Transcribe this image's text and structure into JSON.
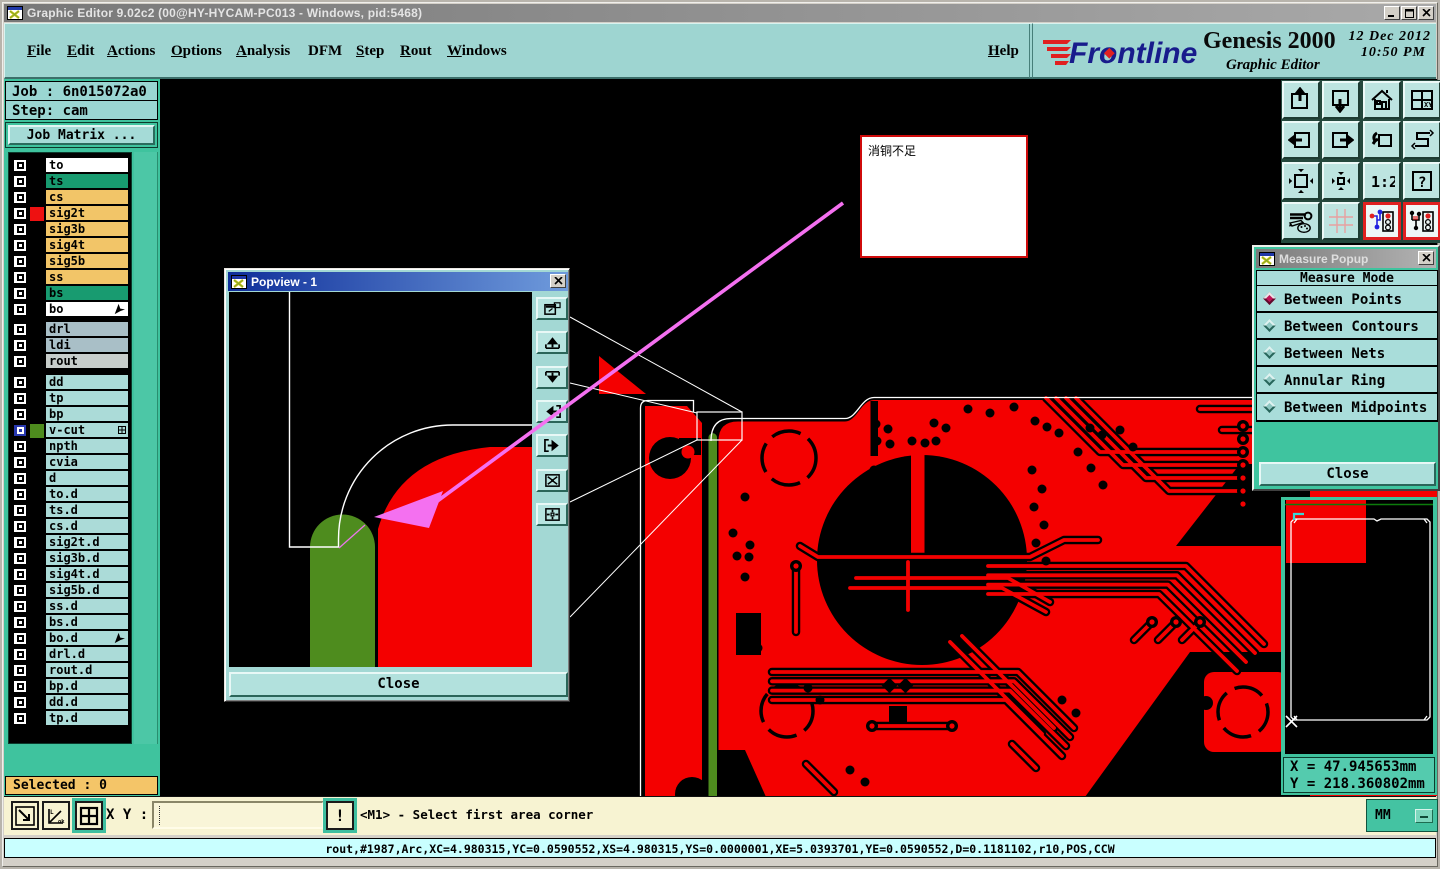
{
  "window": {
    "title": "Graphic Editor 9.02c2 (00@HY-HYCAM-PC013 - Windows, pid:5468)",
    "controls": {
      "minimize": "minimize",
      "maximize": "maximize",
      "close": "close"
    }
  },
  "menu_bar": {
    "items": [
      {
        "label": "File",
        "underline": 0
      },
      {
        "label": "Edit",
        "underline": 0
      },
      {
        "label": "Actions",
        "underline": 0
      },
      {
        "label": "Options",
        "underline": 0
      },
      {
        "label": "Analysis",
        "underline": 0
      },
      {
        "label": "DFM",
        "underline": -1
      },
      {
        "label": "Step",
        "underline": 0
      },
      {
        "label": "Rout",
        "underline": 0
      },
      {
        "label": "Windows",
        "underline": 0
      }
    ],
    "help": {
      "label": "Help",
      "underline": 0
    }
  },
  "brand": {
    "logo_text": "Frontline",
    "product": "Genesis 2000",
    "subtitle": "Graphic Editor",
    "date": "12 Dec 2012",
    "time": "10:50 PM"
  },
  "left_panel": {
    "job_label": "Job : 6n015072a0",
    "step_label": "Step: cam",
    "job_matrix_button": "Job Matrix ...",
    "selected_label": "Selected : 0",
    "layer_groups": [
      {
        "rows": [
          {
            "name": "to",
            "fill": "#ffffff",
            "swatch": null,
            "checked": false
          },
          {
            "name": "ts",
            "fill": "#189b70",
            "swatch": null,
            "checked": false
          },
          {
            "name": "cs",
            "fill": "#f2c568",
            "swatch": null,
            "checked": false
          },
          {
            "name": "sig2t",
            "fill": "#f2c568",
            "swatch": "#ee1111",
            "checked": false
          },
          {
            "name": "sig3b",
            "fill": "#f2c568",
            "swatch": null,
            "checked": false
          },
          {
            "name": "sig4t",
            "fill": "#f2c568",
            "swatch": null,
            "checked": false
          },
          {
            "name": "sig5b",
            "fill": "#f2c568",
            "swatch": null,
            "checked": false
          },
          {
            "name": "ss",
            "fill": "#f2c568",
            "swatch": null,
            "checked": false
          },
          {
            "name": "bs",
            "fill": "#189b70",
            "swatch": null,
            "checked": false
          },
          {
            "name": "bo",
            "fill": "#ffffff",
            "swatch": null,
            "checked": false,
            "cursor": true
          }
        ]
      },
      {
        "rows": [
          {
            "name": "drl",
            "fill": "#a9bfc7",
            "swatch": null,
            "checked": false
          },
          {
            "name": "ldi",
            "fill": "#a9bfc7",
            "swatch": null,
            "checked": false
          },
          {
            "name": "rout",
            "fill": "#c7cdcb",
            "swatch": null,
            "checked": false
          }
        ]
      },
      {
        "rows": [
          {
            "name": "dd",
            "fill": "#abdbd8",
            "swatch": null,
            "checked": false
          },
          {
            "name": "tp",
            "fill": "#abdbd8",
            "swatch": null,
            "checked": false
          },
          {
            "name": "bp",
            "fill": "#abdbd8",
            "swatch": null,
            "checked": false
          },
          {
            "name": "v-cut",
            "fill": "#abdbd8",
            "swatch": "#4e8c1e",
            "checked": false,
            "active": true,
            "grid": true
          },
          {
            "name": "npth",
            "fill": "#abdbd8",
            "swatch": null,
            "checked": false
          },
          {
            "name": "cvia",
            "fill": "#abdbd8",
            "swatch": null,
            "checked": false
          },
          {
            "name": "d",
            "fill": "#abdbd8",
            "swatch": null,
            "checked": false
          },
          {
            "name": "to.d",
            "fill": "#abdbd8",
            "swatch": null,
            "checked": false
          },
          {
            "name": "ts.d",
            "fill": "#abdbd8",
            "swatch": null,
            "checked": false
          },
          {
            "name": "cs.d",
            "fill": "#abdbd8",
            "swatch": null,
            "checked": false
          },
          {
            "name": "sig2t.d",
            "fill": "#abdbd8",
            "swatch": null,
            "checked": false
          },
          {
            "name": "sig3b.d",
            "fill": "#abdbd8",
            "swatch": null,
            "checked": false
          },
          {
            "name": "sig4t.d",
            "fill": "#abdbd8",
            "swatch": null,
            "checked": false
          },
          {
            "name": "sig5b.d",
            "fill": "#abdbd8",
            "swatch": null,
            "checked": false
          },
          {
            "name": "ss.d",
            "fill": "#abdbd8",
            "swatch": null,
            "checked": false
          },
          {
            "name": "bs.d",
            "fill": "#abdbd8",
            "swatch": null,
            "checked": false
          },
          {
            "name": "bo.d",
            "fill": "#abdbd8",
            "swatch": null,
            "checked": false,
            "cursor": true
          },
          {
            "name": "drl.d",
            "fill": "#abdbd8",
            "swatch": null,
            "checked": false
          },
          {
            "name": "rout.d",
            "fill": "#abdbd8",
            "swatch": null,
            "checked": false
          },
          {
            "name": "bp.d",
            "fill": "#abdbd8",
            "swatch": null,
            "checked": false
          },
          {
            "name": "dd.d",
            "fill": "#abdbd8",
            "swatch": null,
            "checked": false
          },
          {
            "name": "tp.d",
            "fill": "#abdbd8",
            "swatch": null,
            "checked": false
          }
        ]
      }
    ]
  },
  "toolbar": {
    "buttons": [
      {
        "icon": "square-arrow-up-icon"
      },
      {
        "icon": "square-arrow-down-icon"
      },
      {
        "icon": "home-icon"
      },
      {
        "icon": "split-window-xy-icon"
      },
      {
        "icon": "square-arrow-left-icon"
      },
      {
        "icon": "square-arrow-right-icon"
      },
      {
        "icon": "undo-view-icon"
      },
      {
        "icon": "net-path-icon"
      },
      {
        "icon": "expand-view-icon"
      },
      {
        "icon": "center-view-icon"
      },
      {
        "icon": "scale-1-2-icon",
        "text": "1:2"
      },
      {
        "icon": "help-q-icon",
        "text": "?"
      },
      {
        "icon": "setup-tools-icon"
      },
      {
        "icon": "snap-grid-icon"
      },
      {
        "icon": "netlist-compare-blue-icon",
        "red_frame": true
      },
      {
        "icon": "netlist-compare-black-icon",
        "red_frame": true
      }
    ]
  },
  "popview": {
    "title": "Popview - 1",
    "close_button": "Close",
    "buttons": [
      {
        "icon": "popview-new-icon"
      },
      {
        "icon": "pan-up-icon"
      },
      {
        "icon": "pan-down-icon"
      },
      {
        "icon": "pan-left-icon"
      },
      {
        "icon": "pan-right-icon"
      },
      {
        "icon": "fit-view-icon"
      },
      {
        "icon": "center-origin-icon"
      }
    ]
  },
  "measure_popup": {
    "title": "Measure Popup",
    "header": "Measure Mode",
    "options": [
      {
        "label": "Between Points",
        "selected": true
      },
      {
        "label": "Between Contours",
        "selected": false
      },
      {
        "label": "Between Nets",
        "selected": false
      },
      {
        "label": "Annular Ring",
        "selected": false
      },
      {
        "label": "Between Midpoints",
        "selected": false
      }
    ],
    "close_button": "Close"
  },
  "annotation": {
    "text": "消铜不足"
  },
  "navigator": {
    "x_readout": "X = 47.945653mm",
    "y_readout": "Y = 218.360802mm"
  },
  "bottom_toolbar": {
    "buttons": [
      {
        "icon": "diag-arrow-icon"
      },
      {
        "icon": "measure-angle-icon"
      },
      {
        "icon": "grid-window-icon",
        "highlight": true
      }
    ],
    "xy_label": "X Y :",
    "xy_value": "",
    "alert_button": "!",
    "message": "<M1> - Select first area corner",
    "units": "MM"
  },
  "status_bar": "rout,#1987,Arc,XC=4.980315,YC=0.0590552,XS=4.980315,YS=0.0000001,XE=5.0393701,YE=0.0590552,D=0.1181102,r10,POS,CCW",
  "colors": {
    "copper": "#f40000",
    "vcut_green": "#4e8c1e",
    "annotation_magenta": "#f470f0",
    "teal_ui": "#9ed5d1",
    "panel_green": "#3fc39e",
    "status_cyan": "#c9ffff",
    "selected_orange": "#f4c568",
    "logo_blue": "#181c8c",
    "logo_red": "#e02020"
  }
}
